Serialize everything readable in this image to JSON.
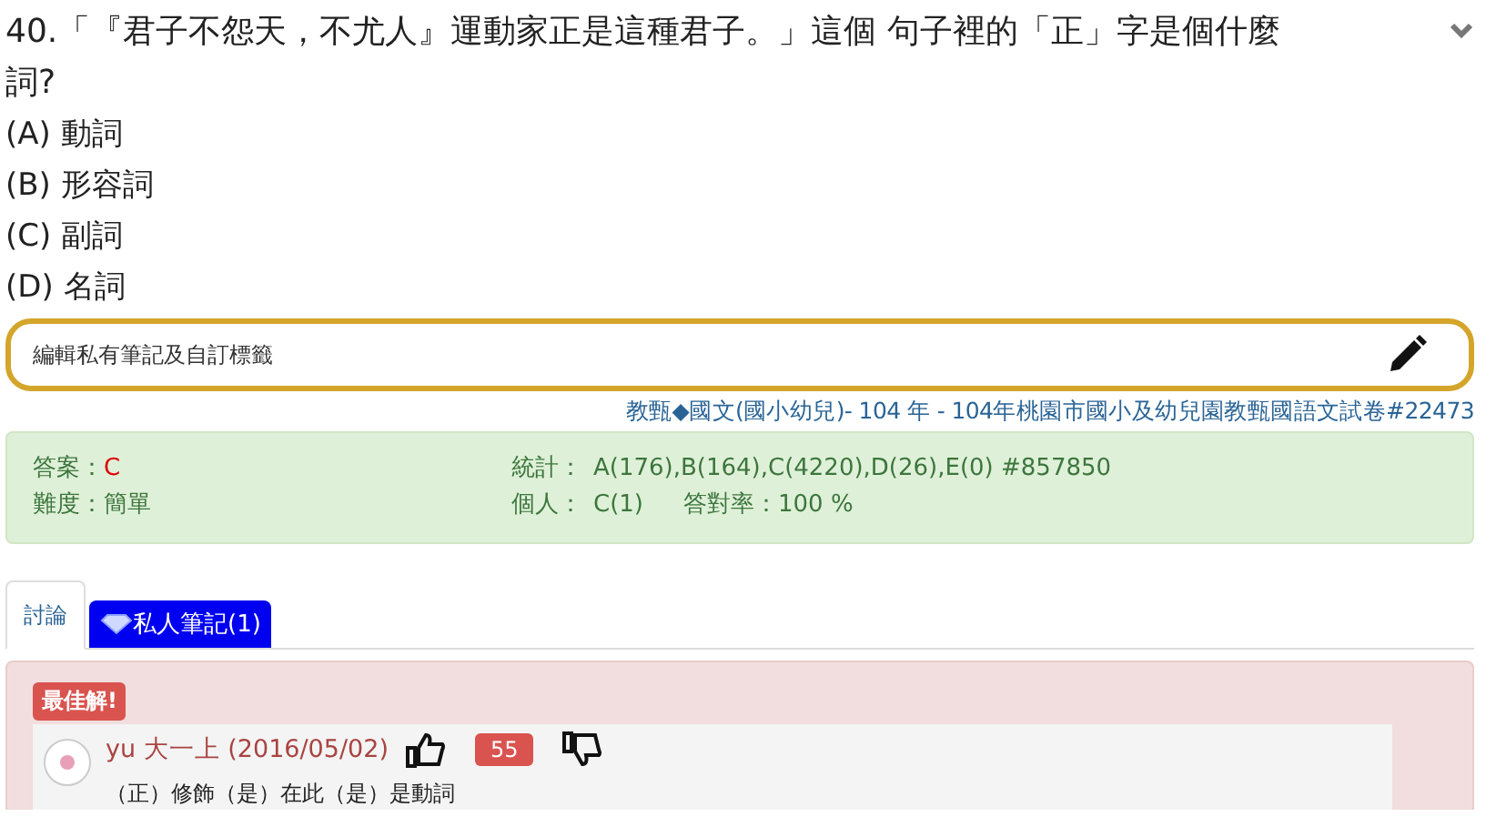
{
  "question": {
    "text": "40.「『君子不怨天，不尤人』運動家正是這種君子。」這個 句子裡的「正」字是個什麼詞?",
    "options": [
      "(A) 動詞",
      "(B) 形容詞",
      "(C) 副詞",
      "(D) 名詞"
    ]
  },
  "note_box": {
    "placeholder": "編輯私有筆記及自訂標籤"
  },
  "source": "教甄◆國文(國小幼兒)- 104 年 - 104年桃園市國小及幼兒園教甄國語文試卷#22473",
  "stats": {
    "answer_label": "答案：",
    "answer": "C",
    "difficulty": "難度：簡單",
    "stats_label": "統計：",
    "stats_value": "A(176),B(164),C(4220),D(26),E(0) #857850",
    "personal_label": "個人：",
    "personal_value": "C(1)",
    "rate": "答對率：100 %"
  },
  "tabs": [
    {
      "label": "討論",
      "selected": true
    },
    {
      "label": "私人筆記(1)",
      "selected": false
    }
  ],
  "best": {
    "badge": "最佳解!",
    "author": "yu 大一上 (2016/05/02)",
    "votes": "55",
    "text": "（正）修飾（是）在此（是）是動詞"
  }
}
